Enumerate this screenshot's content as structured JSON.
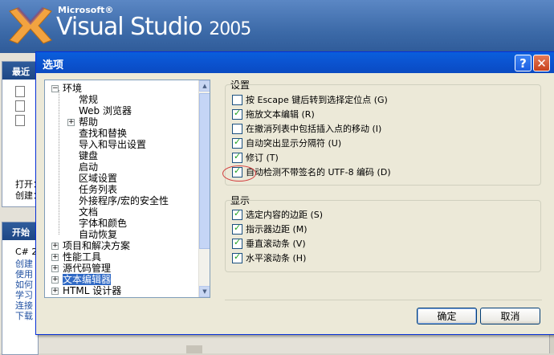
{
  "vs": {
    "brand_small": "Microsoft®",
    "product": "Visual Studio",
    "version": "2005",
    "recent_panel_title": "最近",
    "start_panel_title": "开始",
    "open_label": "打开：",
    "create_label": "创建：",
    "start_items": [
      "C# 2",
      "创建",
      "使用",
      "如何",
      "学习",
      "连接",
      "下载"
    ]
  },
  "dialog": {
    "title": "选项",
    "help_glyph": "?",
    "close_glyph": "✕",
    "tree": [
      {
        "label": "环境",
        "level": 0,
        "expander": "−"
      },
      {
        "label": "常规",
        "level": 1
      },
      {
        "label": "Web 浏览器",
        "level": 1
      },
      {
        "label": "帮助",
        "level": 1,
        "expander": "+"
      },
      {
        "label": "查找和替换",
        "level": 1
      },
      {
        "label": "导入和导出设置",
        "level": 1
      },
      {
        "label": "键盘",
        "level": 1
      },
      {
        "label": "启动",
        "level": 1
      },
      {
        "label": "区域设置",
        "level": 1
      },
      {
        "label": "任务列表",
        "level": 1
      },
      {
        "label": "外接程序/宏的安全性",
        "level": 1
      },
      {
        "label": "文档",
        "level": 1
      },
      {
        "label": "字体和颜色",
        "level": 1
      },
      {
        "label": "自动恢复",
        "level": 1
      },
      {
        "label": "项目和解决方案",
        "level": 0,
        "expander": "+"
      },
      {
        "label": "性能工具",
        "level": 0,
        "expander": "+"
      },
      {
        "label": "源代码管理",
        "level": 0,
        "expander": "+"
      },
      {
        "label": "文本编辑器",
        "level": 0,
        "expander": "+",
        "selected": true
      },
      {
        "label": "HTML 设计器",
        "level": 0,
        "expander": "+"
      }
    ],
    "settings_group": {
      "label": "设置",
      "options": [
        {
          "label": "按 Escape 键后转到选择定位点",
          "key": "G",
          "checked": false
        },
        {
          "label": "拖放文本编辑",
          "key": "R",
          "checked": true
        },
        {
          "label": "在撤消列表中包括插入点的移动",
          "key": "I",
          "checked": false
        },
        {
          "label": "自动突出显示分隔符",
          "key": "U",
          "checked": true
        },
        {
          "label": "修订",
          "key": "T",
          "checked": true
        },
        {
          "label": "自动检测不带签名的 UTF-8 编码",
          "key": "D",
          "checked": true
        }
      ]
    },
    "display_group": {
      "label": "显示",
      "options": [
        {
          "label": "选定内容的边距",
          "key": "S",
          "checked": true
        },
        {
          "label": "指示器边距",
          "key": "M",
          "checked": true
        },
        {
          "label": "垂直滚动条",
          "key": "V",
          "checked": true
        },
        {
          "label": "水平滚动条",
          "key": "H",
          "checked": true
        }
      ]
    },
    "ok_label": "确定",
    "cancel_label": "取消"
  },
  "colors": {
    "titlebar": "#0a5fdd",
    "selection": "#316ac5",
    "check": "#21a121",
    "annotation_circle": "#d23b3b"
  }
}
